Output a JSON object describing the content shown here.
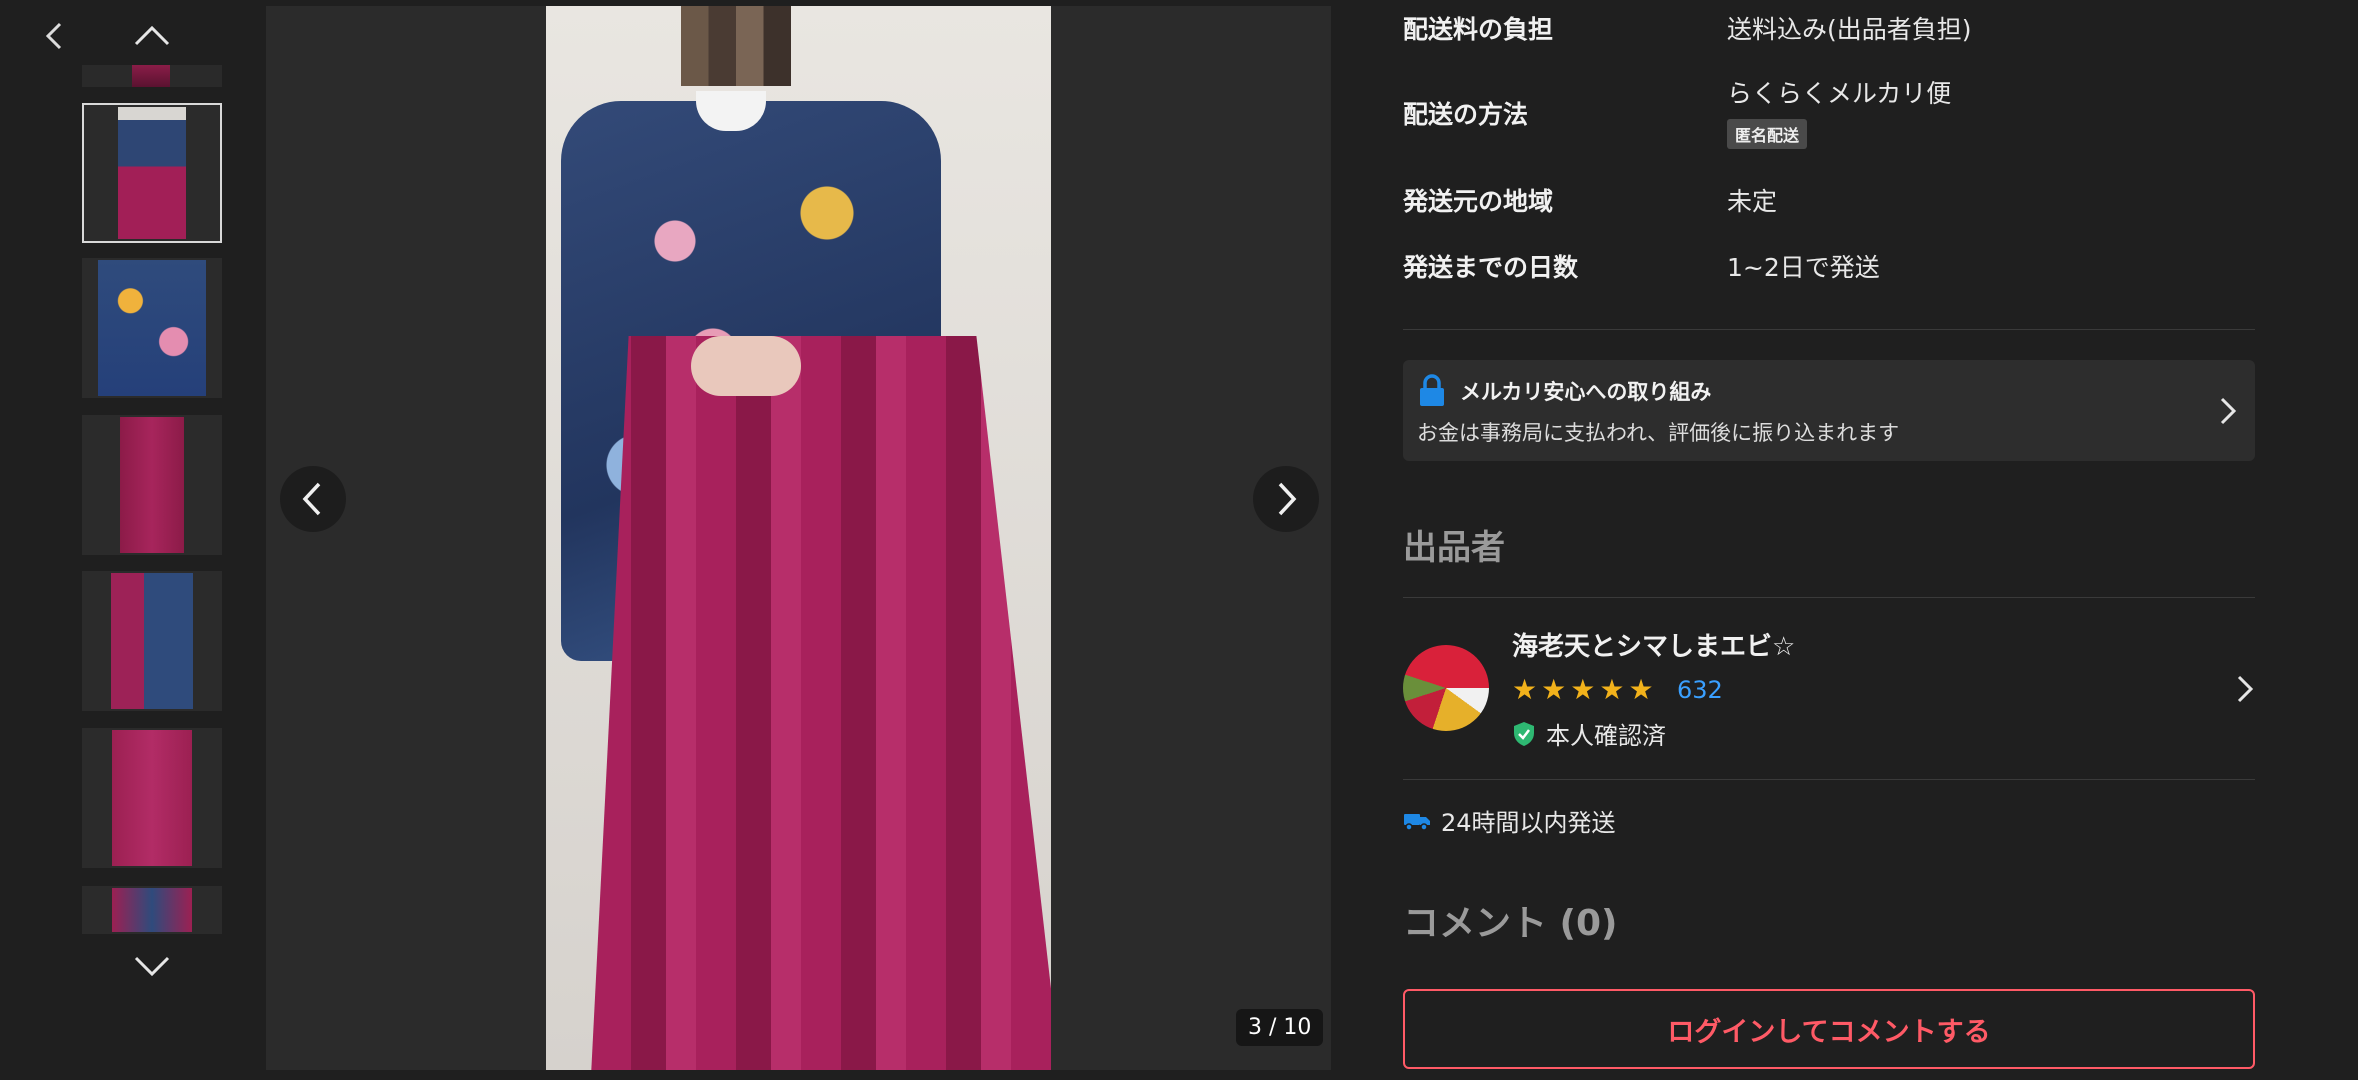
{
  "thumbnails": [
    "thumb-1",
    "thumb-2",
    "thumb-3",
    "thumb-4",
    "thumb-5",
    "thumb-6",
    "thumb-7"
  ],
  "viewer": {
    "counter": "3 / 10"
  },
  "shipping": [
    {
      "label": "配送料の負担",
      "value": "送料込み(出品者負担)"
    },
    {
      "label": "配送の方法",
      "value": "らくらくメルカリ便",
      "tag": "匿名配送"
    },
    {
      "label": "発送元の地域",
      "value": "未定"
    },
    {
      "label": "発送までの日数",
      "value": "1~2日で発送"
    }
  ],
  "safety": {
    "title": "メルカリ安心への取り組み",
    "subtitle": "お金は事務局に支払われ、評価後に振り込まれます"
  },
  "seller": {
    "section_title": "出品者",
    "name": "海老天とシマしまエビ☆",
    "rating_count": "632",
    "stars": 5,
    "verified": "本人確認済"
  },
  "shipping_badge": "24時間以内発送",
  "comments": {
    "title": "コメント (0)",
    "login_button": "ログインしてコメントする"
  },
  "colors": {
    "accent_red": "#ff5a66",
    "star": "#f2b21b",
    "link_blue": "#3aa0ff",
    "verified_green": "#2eb872",
    "lock_blue": "#1e88e5"
  }
}
